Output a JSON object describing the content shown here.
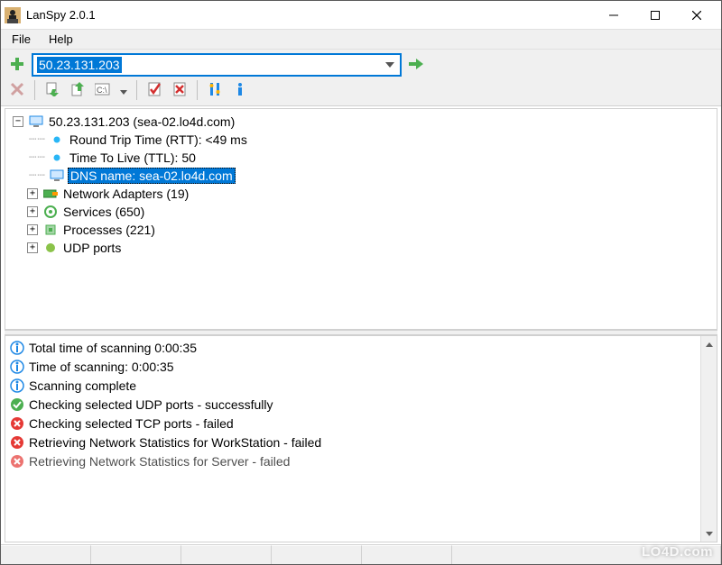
{
  "window": {
    "title": "LanSpy 2.0.1"
  },
  "menu": {
    "file": "File",
    "help": "Help"
  },
  "address": {
    "value": "50.23.131.203"
  },
  "tree": {
    "root": "50.23.131.203 (sea-02.lo4d.com)",
    "rtt": "Round Trip Time (RTT): <49 ms",
    "ttl": "Time To Live (TTL): 50",
    "dns": "DNS name: sea-02.lo4d.com",
    "adapters": "Network Adapters (19)",
    "services": "Services (650)",
    "processes": "Processes (221)",
    "udp": "UDP ports"
  },
  "log": {
    "l0": "Total time of scanning 0:00:35",
    "l1": "Time of scanning: 0:00:35",
    "l2": "Scanning complete",
    "l3": "Checking selected UDP ports - successfully",
    "l4": "Checking selected TCP ports - failed",
    "l5": "Retrieving Network Statistics for WorkStation - failed",
    "l6": "Retrieving Network Statistics for Server - failed"
  },
  "watermark": "LO4D.com"
}
